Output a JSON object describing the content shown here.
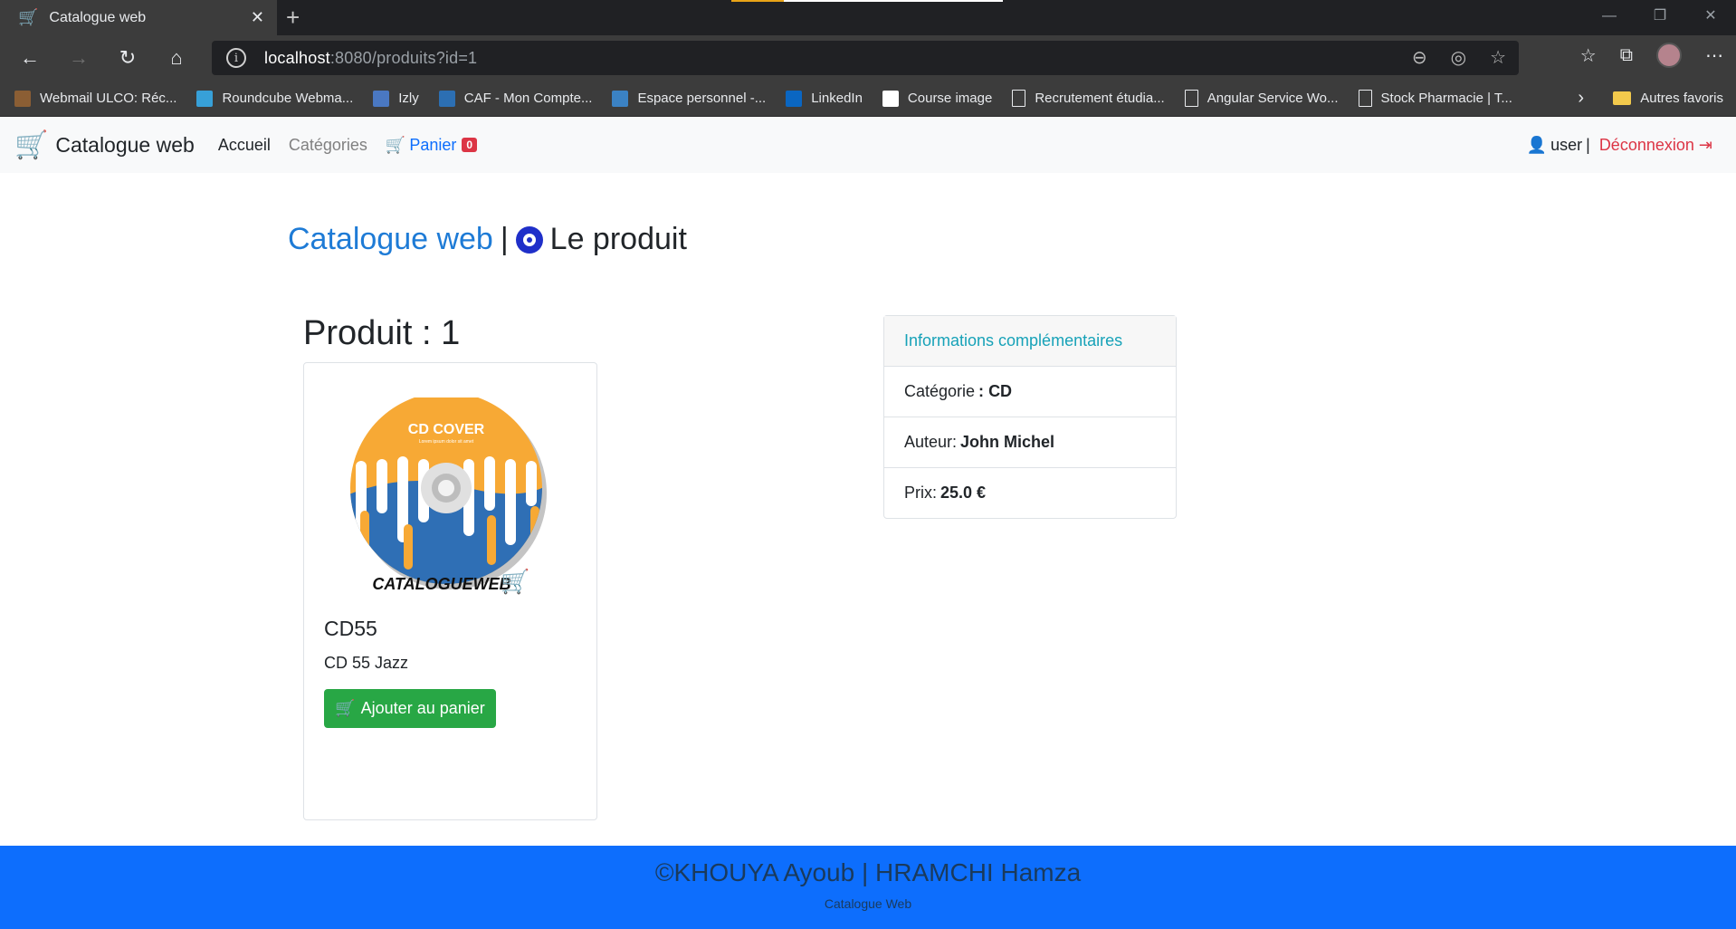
{
  "browser": {
    "tab_title": "Catalogue web",
    "url_host": "localhost",
    "url_rest": ":8080/produits?id=1",
    "bookmarks": [
      {
        "label": "Webmail ULCO: Réc...",
        "icon": "ulco-icon",
        "color": "#8b5e34"
      },
      {
        "label": "Roundcube Webma...",
        "icon": "roundcube-icon",
        "color": "#37a0d8"
      },
      {
        "label": "Izly",
        "icon": "izly-icon",
        "color": "#4a78c2"
      },
      {
        "label": "CAF - Mon Compte...",
        "icon": "caf-icon",
        "color": "#2c6fb3"
      },
      {
        "label": "Espace personnel -...",
        "icon": "espace-icon",
        "color": "#3b82c4"
      },
      {
        "label": "LinkedIn",
        "icon": "linkedin-icon",
        "color": "#0a66c2"
      },
      {
        "label": "Course image",
        "icon": "course-icon",
        "color": "#ffffff"
      },
      {
        "label": "Recrutement étudia...",
        "icon": "page-icon",
        "color": "#3c3c3c"
      },
      {
        "label": "Angular Service Wo...",
        "icon": "page-icon",
        "color": "#3c3c3c"
      },
      {
        "label": "Stock Pharmacie | T...",
        "icon": "page-icon",
        "color": "#3c3c3c"
      }
    ],
    "other_favorites": "Autres favoris"
  },
  "nav": {
    "brand": "Catalogue web",
    "home": "Accueil",
    "categories": "Catégories",
    "cart": "Panier",
    "cart_count": "0",
    "user": "user",
    "separator": "|",
    "logout": "Déconnexion"
  },
  "heading": {
    "brand": "Catalogue web",
    "separator": "|",
    "title": "Le produit"
  },
  "product": {
    "title": "Produit : 1",
    "image_caption": "CD COVER",
    "image_subcaption": "Lorem ipsum dolor sit amet",
    "image_logo": "CATALOGUEWEB",
    "name": "CD55",
    "description": "CD 55 Jazz",
    "add_to_cart": "Ajouter au panier"
  },
  "info": {
    "header": "Informations complémentaires",
    "category_label": "Catégorie",
    "category_sep": ":",
    "category_value": "CD",
    "author_label": "Auteur:",
    "author_value": "John Michel",
    "price_label": "Prix:",
    "price_value": "25.0 €"
  },
  "footer": {
    "line1": "©KHOUYA Ayoub | HRAMCHI Hamza",
    "line2": "Catalogue Web"
  },
  "colors": {
    "brand_blue": "#1e7bd6",
    "footer_blue": "#0d6efd",
    "danger": "#dc3545",
    "success": "#28a745",
    "info": "#17a2b8"
  }
}
